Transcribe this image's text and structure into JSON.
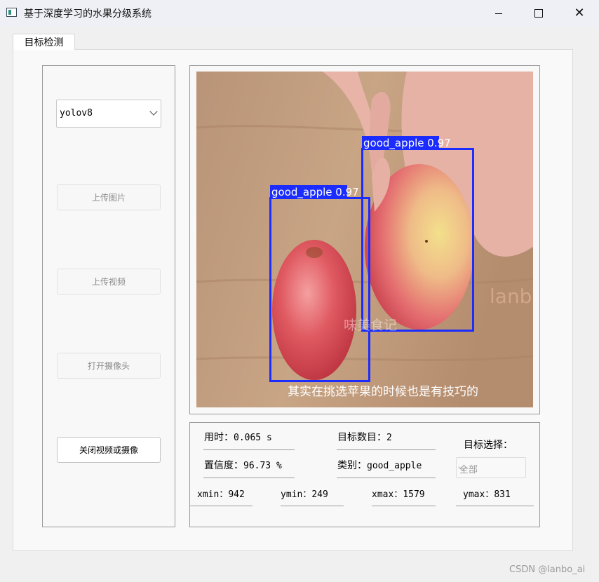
{
  "window": {
    "title": "基于深度学习的水果分级系统"
  },
  "tab": {
    "label": "目标检测"
  },
  "model_select": {
    "value": "yolov8"
  },
  "buttons": {
    "upload_image": "上传图片",
    "upload_video": "上传视频",
    "open_camera": "打开摄像头",
    "close_video": "关闭视频或摄像"
  },
  "image": {
    "detections": [
      {
        "label": "good_apple 0.97"
      },
      {
        "label": "good_apple 0.97"
      }
    ],
    "subtitle": "其实在挑选苹果的时候也是有技巧的",
    "watermark_cn": "味美食记",
    "watermark_en": "lanbo_ai"
  },
  "info": {
    "time_label": "用时：",
    "time_value": "0.065 s",
    "count_label": "目标数目：",
    "count_value": "2",
    "conf_label": "置信度：",
    "conf_value": "96.73 %",
    "class_label": "类别：",
    "class_value": "good_apple",
    "xmin_label": "xmin：",
    "xmin_value": "942",
    "ymin_label": "ymin：",
    "ymin_value": "249",
    "xmax_label": "xmax：",
    "xmax_value": "1579",
    "ymax_label": "ymax：",
    "ymax_value": "831",
    "target_select_label": "目标选择：",
    "target_select_value": "全部"
  },
  "footer": {
    "watermark": "CSDN @lanbo_ai"
  }
}
